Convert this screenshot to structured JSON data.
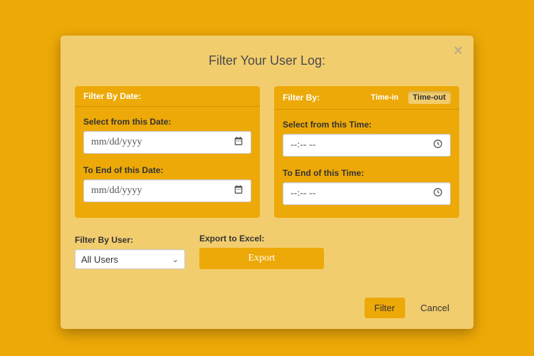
{
  "modal": {
    "title": "Filter Your User Log:"
  },
  "date_card": {
    "header": "Filter By Date:",
    "from_label": "Select from this Date:",
    "from_value": "mm/dd/yyyy",
    "to_label": "To End of this Date:",
    "to_value": "mm/dd/yyyy"
  },
  "time_card": {
    "header": "Filter By:",
    "toggle_timein": "Time-in",
    "toggle_timeout": "Time-out",
    "from_label": "Select from this Time:",
    "from_value": "--:-- --",
    "to_label": "To End of this Time:",
    "to_value": "--:-- --"
  },
  "user_filter": {
    "label": "Filter By User:",
    "selected": "All Users"
  },
  "export": {
    "label": "Export to Excel:",
    "button": "Export"
  },
  "footer": {
    "filter": "Filter",
    "cancel": "Cancel"
  }
}
